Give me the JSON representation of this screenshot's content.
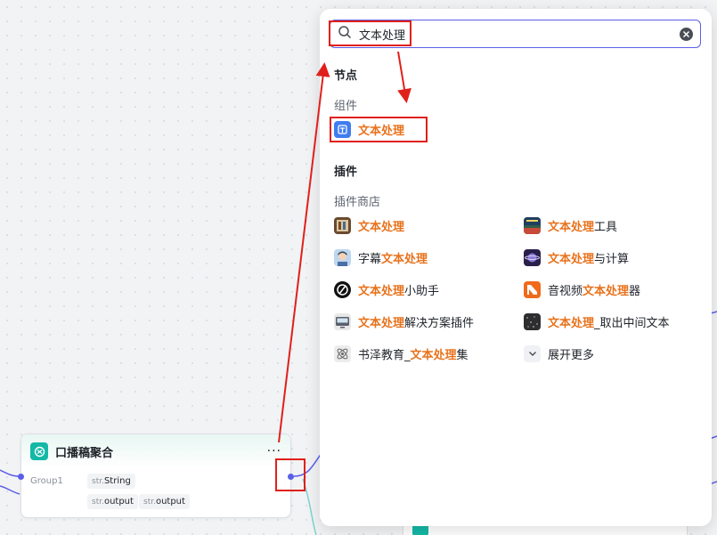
{
  "node": {
    "title": "口播稿聚合",
    "more": "···",
    "group_label": "Group1",
    "input_tag": {
      "prefix": "str.",
      "name": "String"
    },
    "outputs": [
      {
        "prefix": "str.",
        "name": "output"
      },
      {
        "prefix": "str.",
        "name": "output"
      }
    ]
  },
  "search": {
    "value": "文本处理",
    "placeholder": ""
  },
  "sections": {
    "nodes_title": "节点",
    "components_title": "组件",
    "plugins_title": "插件",
    "plugin_store_title": "插件商店"
  },
  "components": [
    {
      "highlight": "文本处理",
      "suffix": "",
      "icon": "text-component-icon"
    }
  ],
  "plugins_left": [
    {
      "prefix": "",
      "highlight": "文本处理",
      "suffix": "",
      "icon": "book-shelf-icon"
    },
    {
      "prefix": "字幕",
      "highlight": "文本处理",
      "suffix": "",
      "icon": "avatar-boy-icon"
    },
    {
      "prefix": "",
      "highlight": "文本处理",
      "suffix": "小助手",
      "icon": "slash-circle-icon"
    },
    {
      "prefix": "",
      "highlight": "文本处理",
      "suffix": "解决方案插件",
      "icon": "monitor-icon"
    },
    {
      "prefix": "书泽教育_",
      "highlight": "文本处理",
      "suffix": "集",
      "icon": "molecule-icon"
    }
  ],
  "plugins_right": [
    {
      "prefix": "",
      "highlight": "文本处理",
      "suffix": "工具",
      "icon": "poster-icon"
    },
    {
      "prefix": "",
      "highlight": "文本处理",
      "suffix": "与计算",
      "icon": "planet-icon"
    },
    {
      "prefix": "音视频",
      "highlight": "文本处理",
      "suffix": "器",
      "icon": "orange-tile-icon"
    },
    {
      "prefix": "",
      "highlight": "文本处理",
      "suffix": "_取出中间文本",
      "icon": "noise-tile-icon"
    }
  ],
  "expand_more": "展开更多",
  "colors": {
    "accent": "#5b5ee8",
    "highlight": "#e8721c",
    "annotation_red": "#e0201b",
    "node_icon": "#14b8a6"
  }
}
